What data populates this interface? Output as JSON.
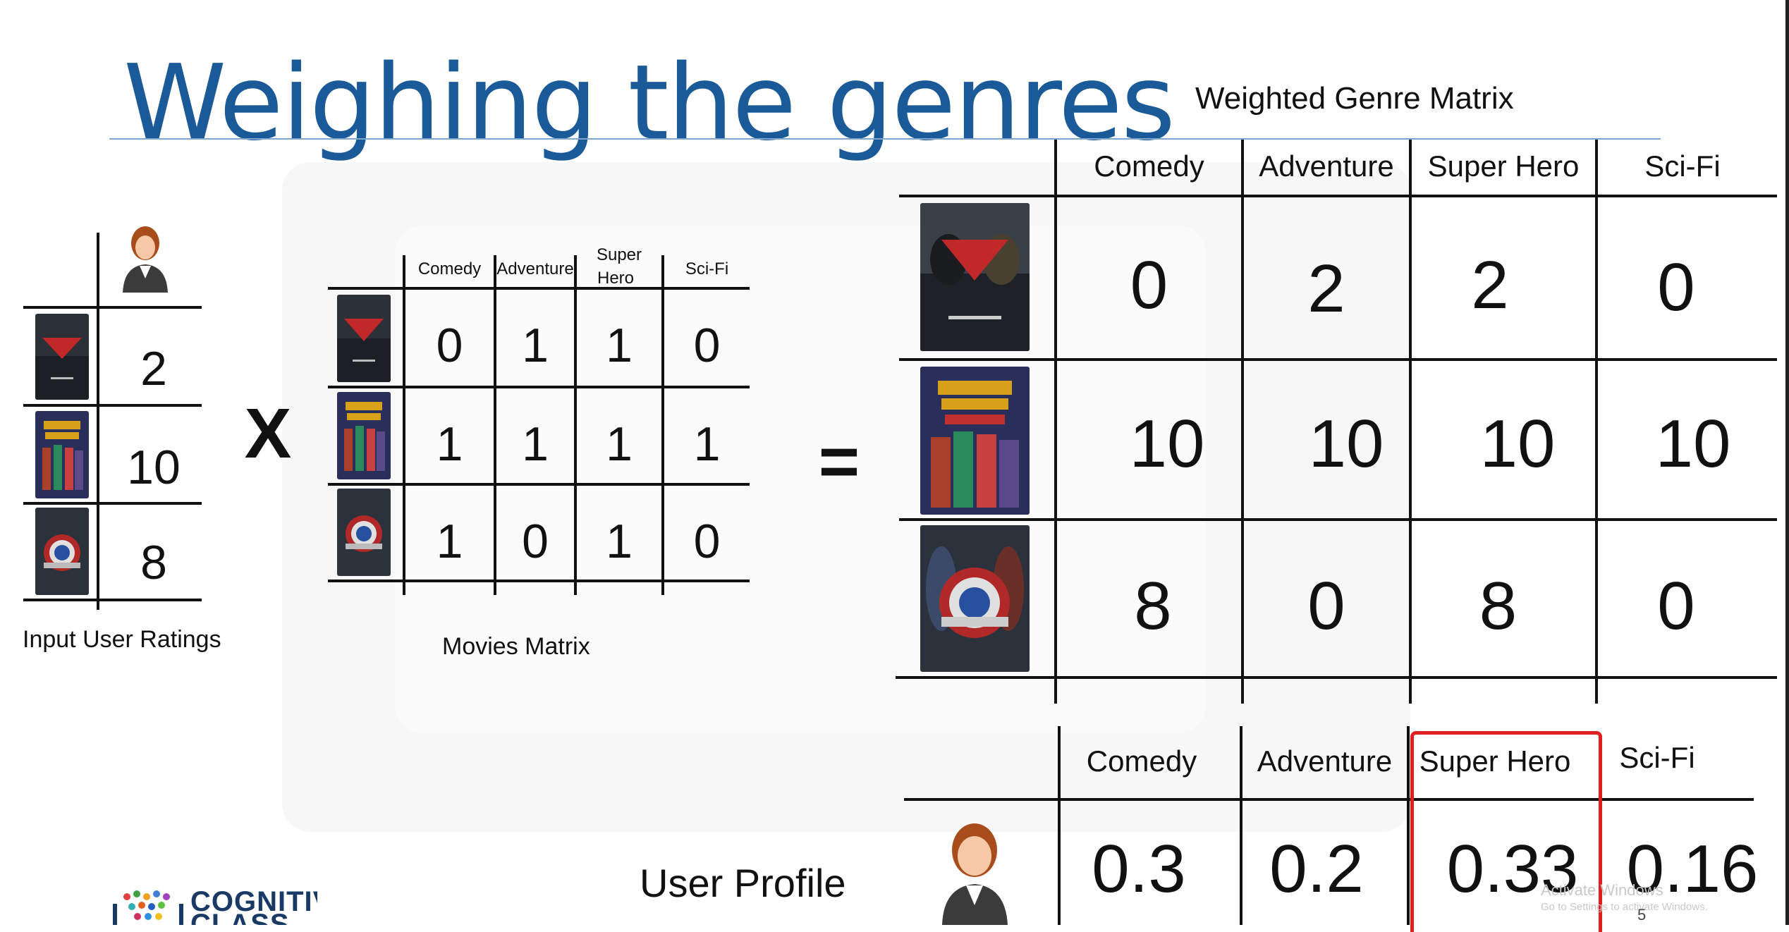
{
  "title": "Weighing the genres",
  "genres": [
    "Comedy",
    "Adventure",
    "Super Hero",
    "Sci-Fi"
  ],
  "movies_matrix": {
    "headers": [
      "Comedy",
      "Adventure",
      "Super",
      "Hero",
      "Sci-Fi"
    ],
    "rows": [
      [
        "0",
        "1",
        "1",
        "0"
      ],
      [
        "1",
        "1",
        "1",
        "1"
      ],
      [
        "1",
        "0",
        "1",
        "0"
      ]
    ],
    "caption": "Movies Matrix"
  },
  "input_ratings": {
    "values": [
      "2",
      "10",
      "8"
    ],
    "caption": "Input User Ratings"
  },
  "operators": {
    "multiply": "X",
    "equals": "="
  },
  "weighted_matrix": {
    "title": "Weighted Genre Matrix",
    "rows": [
      [
        "0",
        "2",
        "2",
        "0"
      ],
      [
        "10",
        "10",
        "10",
        "10"
      ],
      [
        "8",
        "0",
        "8",
        "0"
      ]
    ]
  },
  "user_profile": {
    "label": "User Profile",
    "values": [
      "0.3",
      "0.2",
      "0.33",
      "0.16"
    ],
    "highlighted_genre": "Super Hero",
    "highlight_color": "#e02020"
  },
  "posters": [
    "batman-v-superman-poster",
    "guardians-of-the-galaxy-poster",
    "captain-america-civil-war-poster"
  ],
  "logo": {
    "line1": "COGNITIVE",
    "line2": "CLASS"
  },
  "windows_watermark": {
    "line1": "Activate Windows",
    "line2": "Go to Settings to activate Windows."
  },
  "page_number": "5",
  "colors": {
    "title": "#1a5a99",
    "rule": "#7fa6cf",
    "highlight": "#e02020"
  }
}
